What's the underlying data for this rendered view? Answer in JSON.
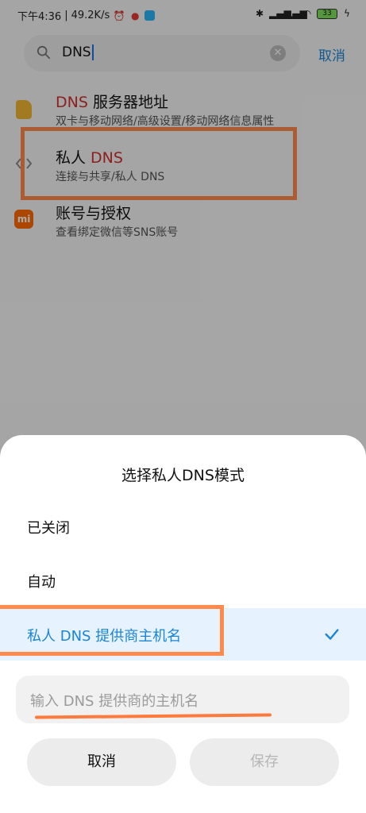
{
  "status_bar": {
    "time": "下午4:36",
    "speed": "49.2K/s",
    "battery": "33"
  },
  "search": {
    "query": "DNS",
    "cancel_label": "取消"
  },
  "results": [
    {
      "title_highlight": "DNS",
      "title_rest": " 服务器地址",
      "subtitle": "双卡与移动网络/高级设置/移动网络信息属性"
    },
    {
      "title_rest": "私人 ",
      "title_highlight": "DNS",
      "subtitle": "连接与共享/私人 DNS"
    },
    {
      "title": "账号与授权",
      "subtitle": "查看绑定微信等SNS账号"
    }
  ],
  "dialog": {
    "title": "选择私人DNS模式",
    "options": [
      {
        "label": "已关闭"
      },
      {
        "label": "自动"
      },
      {
        "label": "私人 DNS 提供商主机名",
        "selected": true
      }
    ],
    "host_placeholder": "输入 DNS 提供商的主机名",
    "cancel_label": "取消",
    "save_label": "保存"
  },
  "colors": {
    "accent": "#1a85d6",
    "highlight": "#d32f2f",
    "annotation": "#ff8a4d"
  }
}
